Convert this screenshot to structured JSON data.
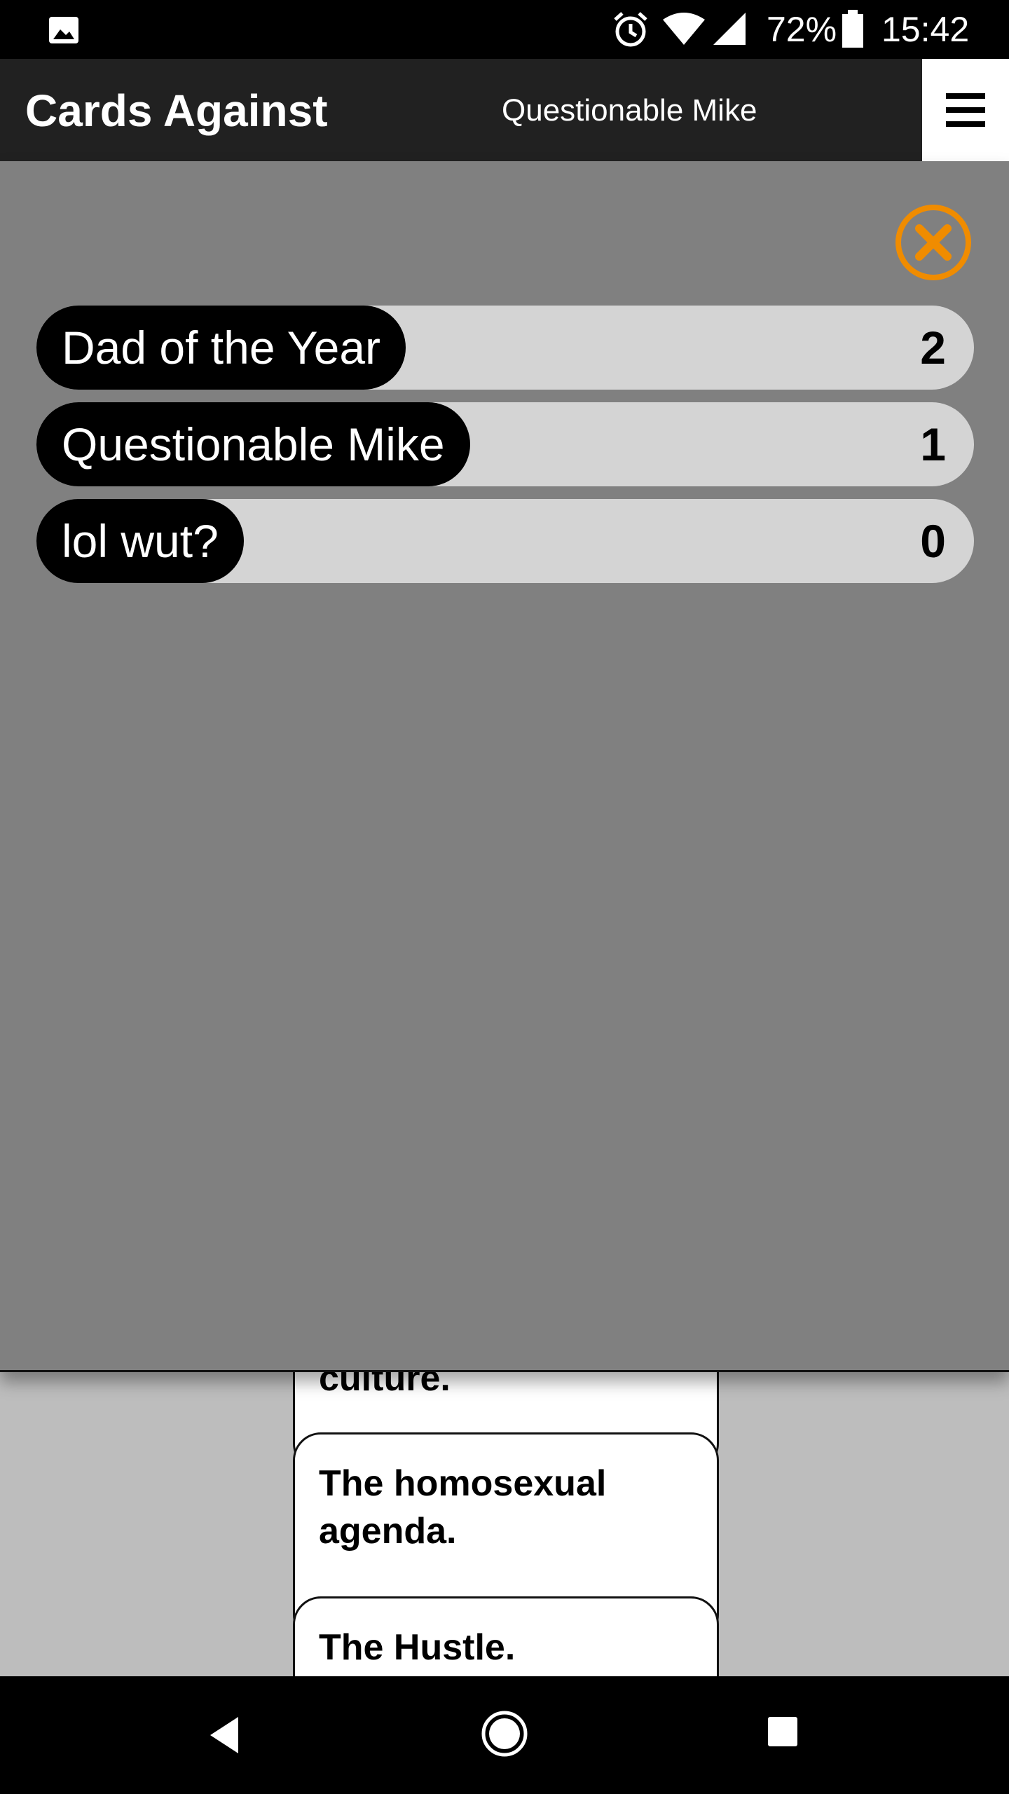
{
  "status_bar": {
    "battery_percent": "72%",
    "time": "15:42",
    "icons": [
      "gallery-icon",
      "alarm-icon",
      "wifi-icon",
      "signal-icon",
      "battery-icon"
    ]
  },
  "app_bar": {
    "title": "Cards Against",
    "player_name": "Questionable Mike",
    "menu_icon": "hamburger-menu-icon"
  },
  "scoreboard": {
    "close_icon": "close-circle-icon",
    "accent_color": "#f08c00",
    "players": [
      {
        "name": "Dad of the Year",
        "score": "2"
      },
      {
        "name": "Questionable Mike",
        "score": "1"
      },
      {
        "name": "lol wut?",
        "score": "0"
      }
    ]
  },
  "cards": [
    {
      "text": "culture."
    },
    {
      "text": "The homosexual agenda."
    },
    {
      "text": "The Hustle."
    }
  ],
  "nav_bar": {
    "icons": [
      "back-icon",
      "home-icon",
      "recents-icon"
    ]
  }
}
